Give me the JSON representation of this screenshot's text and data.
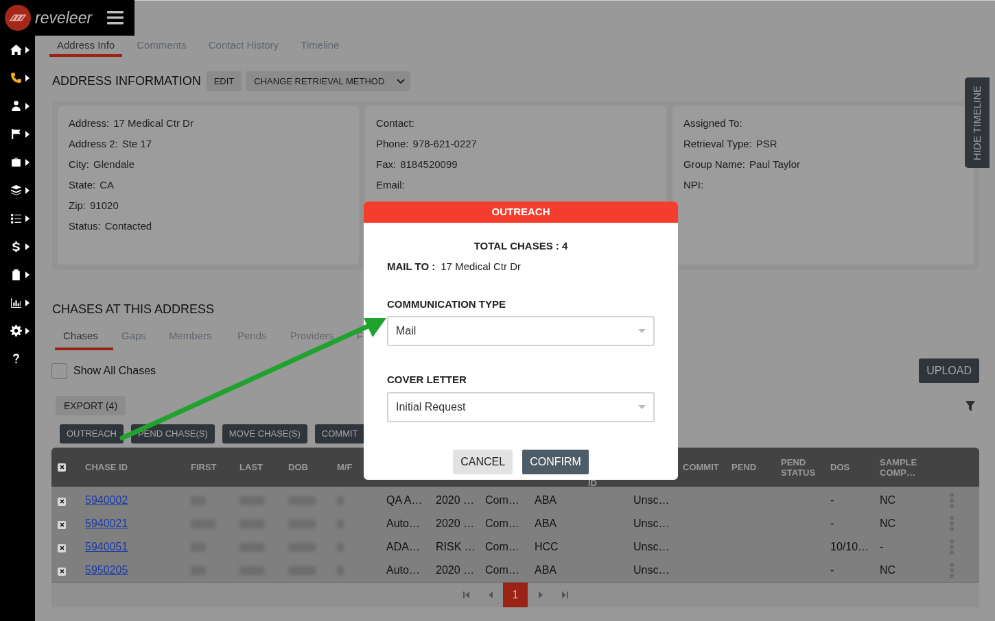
{
  "brand": "reveleer",
  "sidebar": {
    "items": [
      {
        "selected": false,
        "has_submenu": true
      },
      {
        "selected": true,
        "has_submenu": true
      },
      {
        "selected": false,
        "has_submenu": true
      },
      {
        "selected": false,
        "has_submenu": true
      },
      {
        "selected": false,
        "has_submenu": true
      },
      {
        "selected": false,
        "has_submenu": true
      },
      {
        "selected": false,
        "has_submenu": true
      },
      {
        "selected": false,
        "has_submenu": true
      },
      {
        "selected": false,
        "has_submenu": true
      },
      {
        "selected": false,
        "has_submenu": true
      },
      {
        "selected": false,
        "has_submenu": true
      },
      {
        "selected": false,
        "has_submenu": false
      }
    ]
  },
  "tabs": [
    {
      "label": "Address Info",
      "selected": true
    },
    {
      "label": "Comments",
      "selected": false
    },
    {
      "label": "Contact History",
      "selected": false
    },
    {
      "label": "Timeline",
      "selected": false
    }
  ],
  "address_section": {
    "title": "ADDRESS INFORMATION",
    "buttons": [
      "EDIT",
      "CHANGE RETRIEVAL METHOD"
    ],
    "cards": [
      {
        "fields": [
          {
            "label": "Address:",
            "value": "17 Medical Ctr Dr"
          },
          {
            "label": "Address 2:",
            "value": "Ste 17"
          },
          {
            "label": "City:",
            "value": "Glendale"
          },
          {
            "label": "State:",
            "value": "CA"
          },
          {
            "label": "Zip:",
            "value": "91020"
          },
          {
            "label": "Status:",
            "value": "Contacted"
          }
        ]
      },
      {
        "fields": [
          {
            "label": "Contact:"
          },
          {
            "label": "Phone:",
            "value": "978-621-0227"
          },
          {
            "label": "Fax:",
            "value": "8184520099"
          },
          {
            "label": "Email:"
          }
        ]
      },
      {
        "fields": [
          {
            "label": "Assigned To:"
          },
          {
            "label": "Retrieval Type:",
            "value": "PSR"
          },
          {
            "label": "Group Name:",
            "value": "Paul Taylor"
          },
          {
            "label": "NPI:"
          }
        ]
      }
    ]
  },
  "hide_timeline": "HIDE TIMELINE",
  "chases_section": {
    "title": "CHASES AT THIS ADDRESS",
    "tabs": [
      {
        "label": "Chases",
        "selected": true
      },
      {
        "label": "Gaps",
        "selected": false
      },
      {
        "label": "Members",
        "selected": false
      },
      {
        "label": "Pends",
        "selected": false
      },
      {
        "label": "Providers",
        "selected": false
      },
      {
        "label": "F",
        "selected": false
      }
    ],
    "show_all": {
      "label": "Show All Chases",
      "checked": false
    },
    "upload": "UPLOAD",
    "export": "EXPORT (4)",
    "actions": [
      "OUTREACH",
      "PEND CHASE(S)",
      "MOVE CHASE(S)",
      "COMMIT"
    ],
    "table": {
      "select_all_checked": true,
      "columns": [
        "CHASE ID",
        "FIRST",
        "LAST",
        "DOB",
        "M/F",
        null,
        null,
        null,
        null,
        "ID",
        null,
        "COMMIT",
        "PEND",
        "PEND STATUS",
        "DOS",
        "SAMPLE COMP…"
      ],
      "rows": [
        {
          "selected": true,
          "chase_id": "5940002",
          "column_7": "QA A…",
          "column_8": "2020 …",
          "column_9": "Com…",
          "column_10": "ABA",
          "column_12": "Unsc…",
          "dos": "-",
          "sample_comp": "NC"
        },
        {
          "selected": true,
          "chase_id": "5940021",
          "column_7": "Auto…",
          "column_8": "2020 …",
          "column_9": "Com…",
          "column_10": "ABA",
          "column_12": "Unsc…",
          "dos": "-",
          "sample_comp": "NC"
        },
        {
          "selected": true,
          "chase_id": "5940051",
          "column_7": "ADA…",
          "column_8": "RISK …",
          "column_9": "Com…",
          "column_10": "HCC",
          "column_12": "Unsc…",
          "dos": "10/10…",
          "sample_comp": "-"
        },
        {
          "selected": true,
          "chase_id": "5950205",
          "column_7": "Auto…",
          "column_8": "2020 …",
          "column_9": "Com…",
          "column_10": "ABA",
          "column_12": "Unsc…",
          "dos": "-",
          "sample_comp": "NC"
        }
      ]
    },
    "pagination": {
      "pages": [
        {
          "label": "1",
          "selected": true
        }
      ]
    }
  },
  "modal": {
    "title": "OUTREACH",
    "total": "TOTAL CHASES : 4",
    "mail_to_label": "MAIL TO :",
    "mail_to_value": "17 Medical Ctr Dr",
    "fields": [
      {
        "label": "COMMUNICATION TYPE",
        "value": "Mail"
      },
      {
        "label": "COVER LETTER",
        "value": "Initial Request"
      }
    ],
    "buttons": [
      {
        "label": "CANCEL",
        "kind": "secondary"
      },
      {
        "label": "CONFIRM",
        "kind": "primary"
      }
    ]
  }
}
